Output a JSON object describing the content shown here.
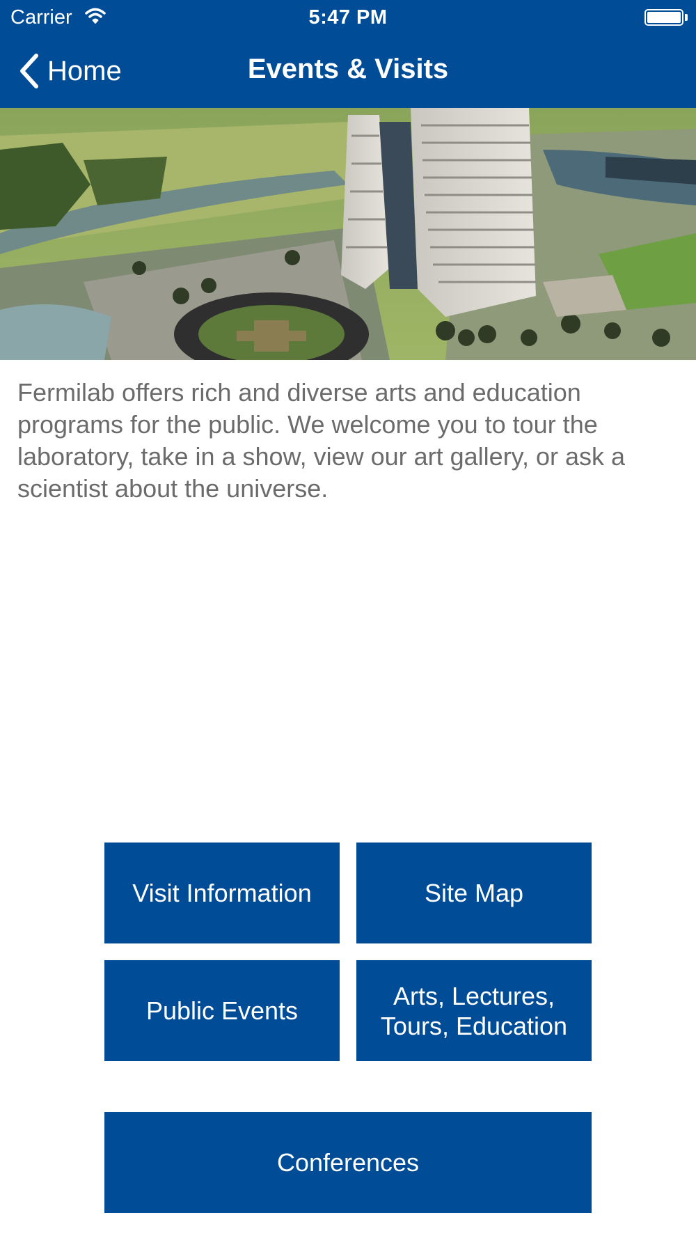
{
  "status_bar": {
    "carrier": "Carrier",
    "time": "5:47 PM"
  },
  "nav": {
    "back_label": "Home",
    "title": "Events & Visits"
  },
  "hero_image": {
    "description_icon": "aerial-photo-of-fermilab-wilson-hall"
  },
  "intro_text": "Fermilab offers rich and diverse arts and education programs for the public. We welcome you to tour the laboratory, take in a show, view our art gallery, or ask a scientist about the universe.",
  "buttons": {
    "visit_information": "Visit Information",
    "site_map": "Site Map",
    "public_events": "Public Events",
    "arts_line1": "Arts, Lectures,",
    "arts_line2": "Tours, Education",
    "conferences": "Conferences"
  },
  "colors": {
    "brand_blue": "#004C97",
    "body_text": "#6b6b6b",
    "background": "#ffffff"
  }
}
